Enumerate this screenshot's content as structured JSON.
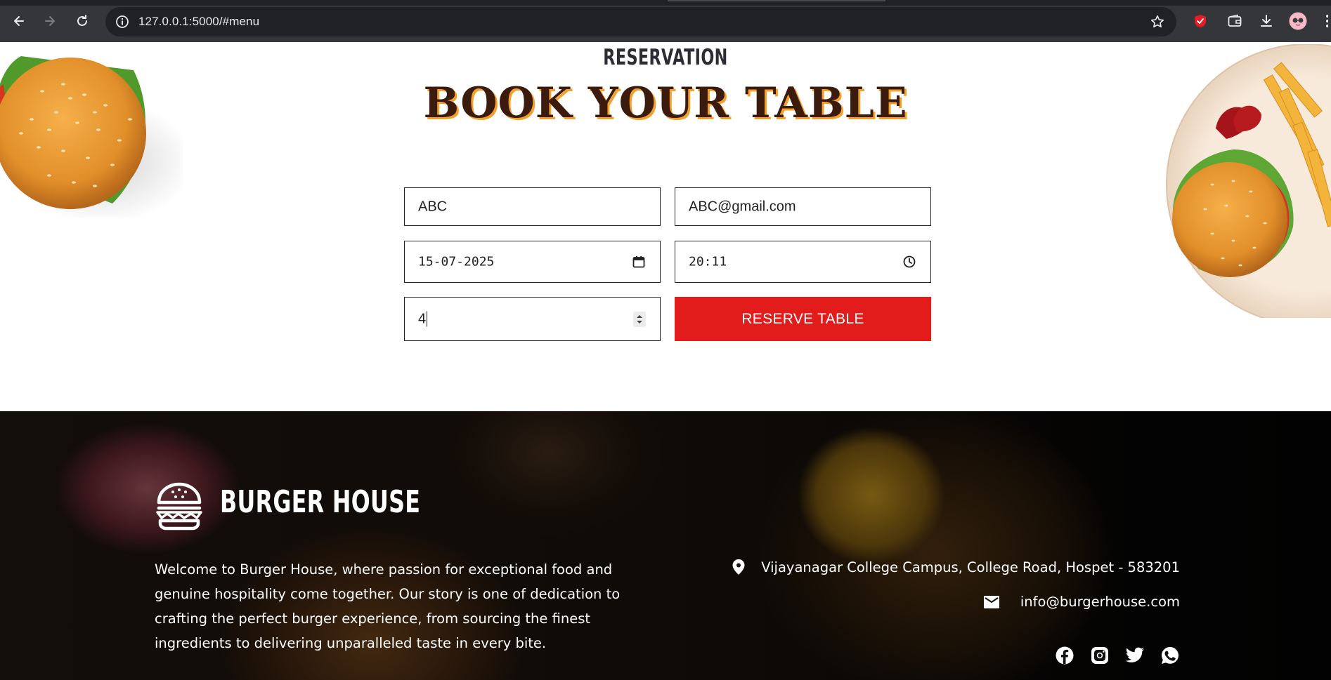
{
  "browser": {
    "url": "127.0.0.1:5000/#menu"
  },
  "reservation": {
    "subtitle": "RESERVATION",
    "title": "BOOK YOUR TABLE",
    "form": {
      "name_value": "ABC",
      "email_value": "ABC@gmail.com",
      "date_value": "15-07-2025",
      "time_value": "20:11",
      "guests_value": "4",
      "submit_label": "RESERVE TABLE"
    }
  },
  "footer": {
    "brand": "BURGER HOUSE",
    "about": "Welcome to Burger House, where passion for exceptional food and genuine hospitality come together. Our story is one of dedication to crafting the perfect burger experience, from sourcing the finest ingredients to delivering unparalleled taste in every bite.",
    "address": "Vijayanagar College Campus, College Road, Hospet - 583201",
    "email": "info@burgerhouse.com",
    "socials": [
      "facebook-icon",
      "instagram-icon",
      "twitter-icon",
      "whatsapp-icon"
    ]
  },
  "colors": {
    "accent_red": "#e21b1b",
    "title_brown": "#3a1b0d",
    "title_shadow": "#f4a12b"
  }
}
